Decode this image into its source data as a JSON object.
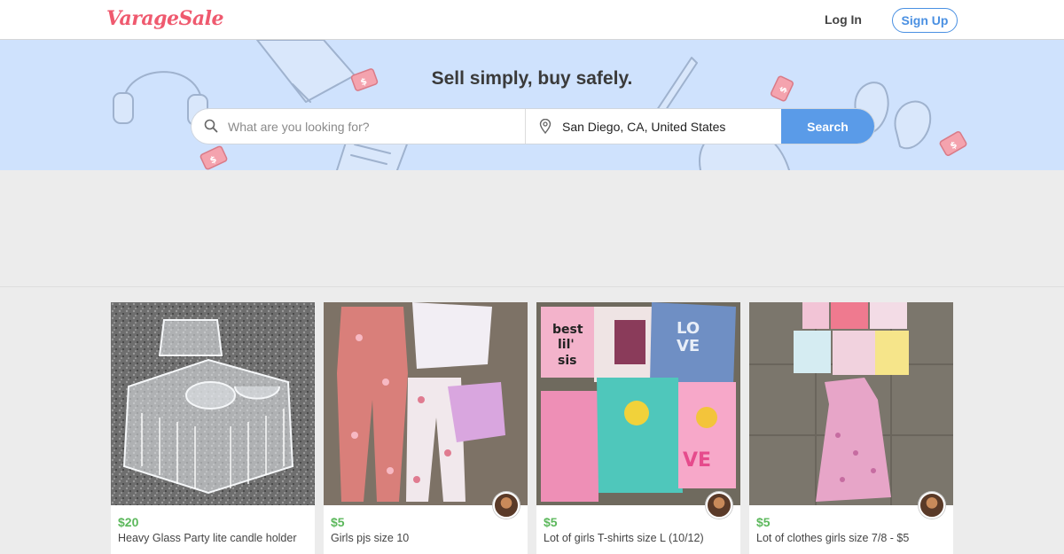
{
  "header": {
    "logo": "VarageSale",
    "login_label": "Log In",
    "signup_label": "Sign Up"
  },
  "hero": {
    "tagline": "Sell simply, buy safely.",
    "search_placeholder": "What are you looking for?",
    "location_value": "San Diego, CA, United States",
    "search_button": "Search"
  },
  "colors": {
    "brand": "#ef5a6f",
    "accent": "#4a90e2",
    "price": "#5cb85c",
    "hero_bg": "#cfe2fd"
  },
  "listings": [
    {
      "price": "$20",
      "title": "Heavy Glass Party lite candle holder",
      "has_avatar": false
    },
    {
      "price": "$5",
      "title": "Girls pjs size 10",
      "has_avatar": true
    },
    {
      "price": "$5",
      "title": "Lot of girls T-shirts size L (10/12)",
      "has_avatar": true
    },
    {
      "price": "$5",
      "title": "Lot of clothes girls size 7/8 - $5",
      "has_avatar": true
    }
  ]
}
